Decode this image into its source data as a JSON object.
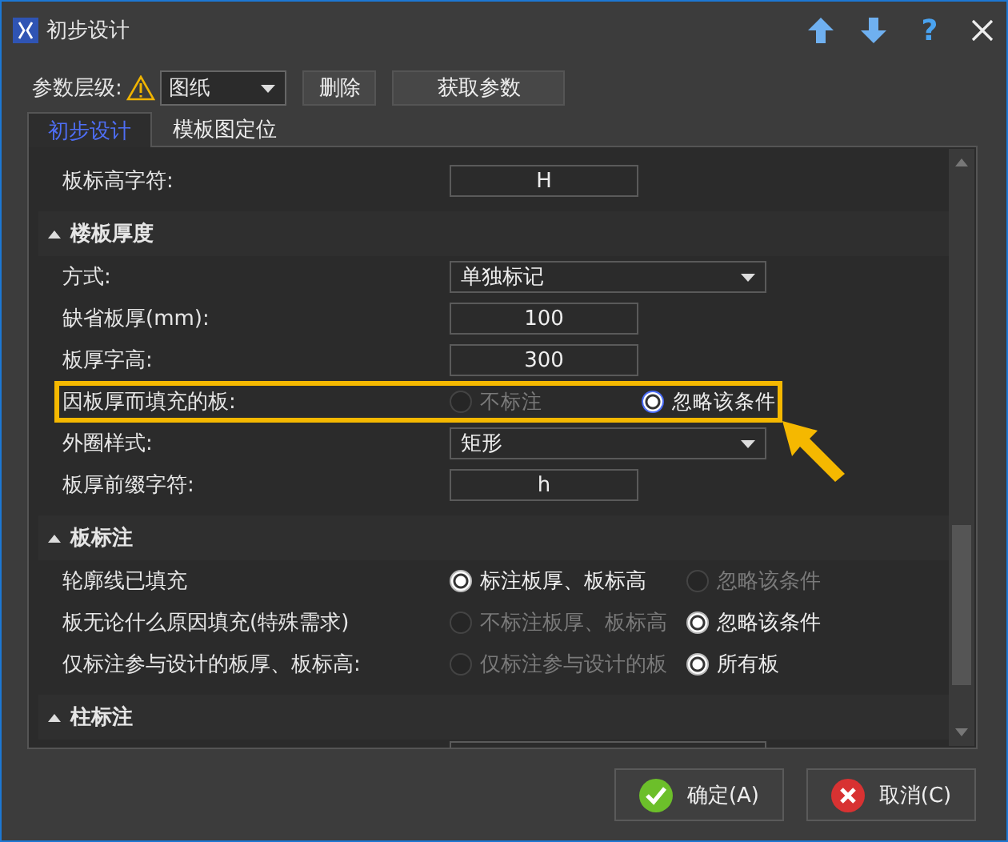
{
  "window": {
    "title": "初步设计",
    "help_button": "?"
  },
  "toolbar": {
    "label": "参数层级:",
    "level_select": {
      "value": "图纸"
    },
    "buttons": [
      "删除",
      "获取参数"
    ]
  },
  "tabs": [
    {
      "label": "初步设计",
      "selected": true
    },
    {
      "label": "模板图定位",
      "selected": false
    }
  ],
  "rows_above": [
    {
      "kind": "text",
      "label": "板标高字符:",
      "value": "H",
      "highlighted": false
    }
  ],
  "sections": [
    {
      "title": "楼板厚度",
      "expanded": true,
      "rows": [
        {
          "kind": "select",
          "label": "方式:",
          "value": "单独标记",
          "highlighted": false
        },
        {
          "kind": "text",
          "label": "缺省板厚(mm):",
          "value": "100",
          "highlighted": false
        },
        {
          "kind": "text",
          "label": "板厚字高:",
          "value": "300",
          "highlighted": false
        },
        {
          "kind": "radio",
          "label": "因板厚而填充的板:",
          "highlighted": true,
          "options": [
            {
              "label": "不标注",
              "selected": false
            },
            {
              "label": "忽略该条件",
              "selected": true
            }
          ]
        },
        {
          "kind": "select",
          "label": "外圈样式:",
          "value": "矩形",
          "highlighted": false
        },
        {
          "kind": "text",
          "label": "板厚前缀字符:",
          "value": "h",
          "highlighted": false
        }
      ]
    },
    {
      "title": "板标注",
      "expanded": true,
      "rows": [
        {
          "kind": "radio",
          "label": "轮廓线已填充",
          "highlighted": false,
          "options": [
            {
              "label": "标注板厚、板标高",
              "selected": true
            },
            {
              "label": "忽略该条件",
              "selected": false
            }
          ]
        },
        {
          "kind": "radio",
          "label": "板无论什么原因填充(特殊需求)",
          "highlighted": false,
          "options": [
            {
              "label": "不标注板厚、板标高",
              "selected": false
            },
            {
              "label": "忽略该条件",
              "selected": true
            }
          ]
        },
        {
          "kind": "radio",
          "label": "仅标注参与设计的板厚、板标高:",
          "highlighted": false,
          "options": [
            {
              "label": "仅标注参与设计的板",
              "selected": false
            },
            {
              "label": "所有板",
              "selected": true
            }
          ]
        }
      ]
    },
    {
      "title": "柱标注",
      "expanded": true,
      "rows": [
        {
          "kind": "select",
          "highlighted": false
        }
      ]
    }
  ],
  "buttons": [
    {
      "kind": "ok",
      "label": "确定(A)"
    },
    {
      "kind": "cancel",
      "label": "取消(C)"
    }
  ]
}
